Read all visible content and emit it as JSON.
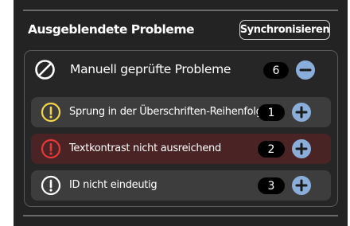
{
  "header": {
    "title": "Ausgeblendete Probleme",
    "sync_label": "Synchronisieren"
  },
  "group": {
    "label": "Manuell geprüfte Probleme",
    "count": "6",
    "icon": "prohibited-icon",
    "action_icon": "minus-icon"
  },
  "items": [
    {
      "label": "Sprung in der Überschriften-Reihenfolge",
      "count": "1",
      "severity": "warning",
      "icon_color": "#f2d54a",
      "icon": "exclamation-circle-icon",
      "action_icon": "plus-icon"
    },
    {
      "label": "Textkontrast nicht ausreichend",
      "count": "2",
      "severity": "error",
      "icon_color": "#e5383b",
      "icon": "exclamation-circle-icon",
      "action_icon": "plus-icon"
    },
    {
      "label": "ID nicht eindeutig",
      "count": "3",
      "severity": "info",
      "icon_color": "#ffffff",
      "icon": "exclamation-circle-icon",
      "action_icon": "plus-icon"
    }
  ],
  "colors": {
    "panel_bg": "#232323",
    "accent_button": "#8aaed9",
    "error_row_bg": "#4a2424"
  }
}
